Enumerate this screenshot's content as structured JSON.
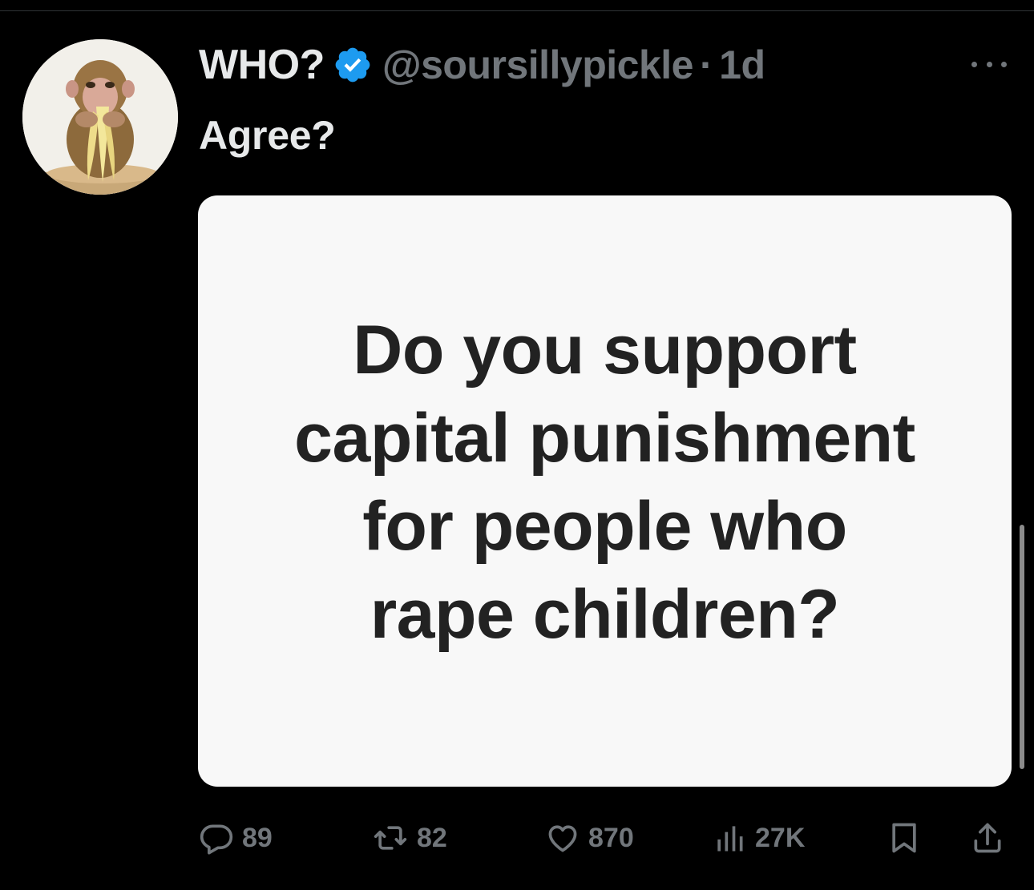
{
  "tweet": {
    "display_name": "WHO?",
    "verified": true,
    "handle": "@soursillypickle",
    "separator": "·",
    "time": "1d",
    "text": "Agree?",
    "avatar_icon": "monkey-eating-banana-avatar",
    "media_lines": [
      "Do you support",
      "capital punishment",
      "for people who",
      "rape children?"
    ]
  },
  "actions": {
    "replies": "89",
    "reposts": "82",
    "likes": "870",
    "views": "27K"
  },
  "icons": {
    "verified": "verified-badge-icon",
    "more": "more-icon",
    "reply": "reply-icon",
    "repost": "repost-icon",
    "like": "heart-icon",
    "views": "views-chart-icon",
    "bookmark": "bookmark-icon",
    "share": "share-icon"
  },
  "colors": {
    "background": "#000000",
    "primary_text": "#e7e9ea",
    "secondary_text": "#71767b",
    "verified_blue": "#1d9bf0",
    "card_background": "#f8f8f8",
    "card_text": "#222222"
  }
}
